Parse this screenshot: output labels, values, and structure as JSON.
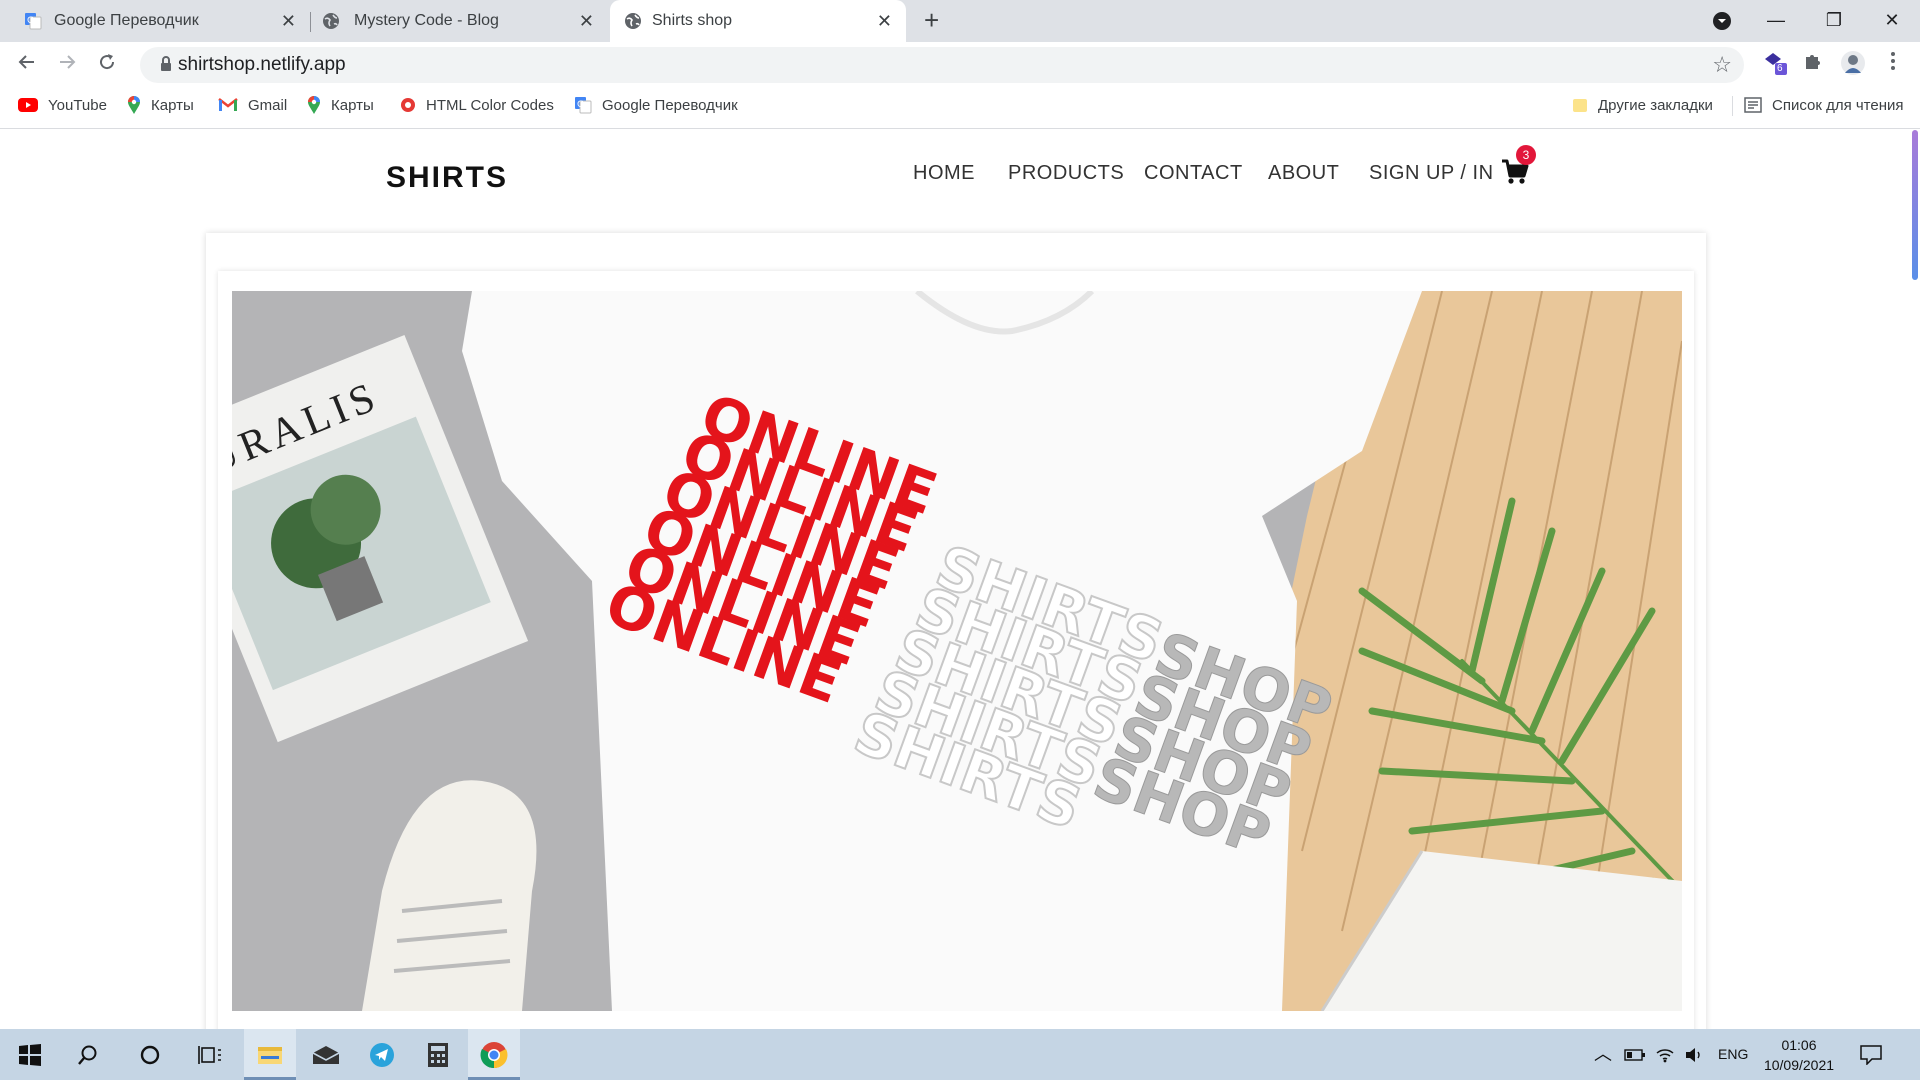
{
  "browser": {
    "tabs": [
      {
        "title": "Google Переводчик",
        "icon": "google-translate-icon",
        "active": false
      },
      {
        "title": "Mystery Code - Blog",
        "icon": "globe-icon",
        "active": false
      },
      {
        "title": "Shirts shop",
        "icon": "globe-icon",
        "active": true
      }
    ],
    "url": "shirtshop.netlify.app",
    "extension_badge": "6",
    "bookmarks": [
      {
        "label": "YouTube",
        "icon": "youtube-icon"
      },
      {
        "label": "Карты",
        "icon": "maps-pin-icon"
      },
      {
        "label": "Gmail",
        "icon": "gmail-icon"
      },
      {
        "label": "Карты",
        "icon": "maps-pin-icon"
      },
      {
        "label": "HTML Color Codes",
        "icon": "color-codes-icon"
      },
      {
        "label": "Google Переводчик",
        "icon": "google-translate-icon"
      }
    ],
    "other_bookmarks": "Другие закладки",
    "reading_list": "Список для чтения"
  },
  "site": {
    "logo": "SHIRTS",
    "nav": [
      "HOME",
      "PRODUCTS",
      "CONTACT",
      "ABOUT",
      "SIGN UP / IN"
    ],
    "cart_count": "3",
    "hero": {
      "word_red": "ONLINE",
      "word_white": "SHIRTS",
      "word_grey": "SHOP",
      "magazine_text": "TURALIS",
      "colors": {
        "red": "#e4141b",
        "grey_bg": "#b4b4b6",
        "wood": "#e9c79a",
        "leaf": "#5e9a44"
      }
    }
  },
  "taskbar": {
    "lang": "ENG",
    "time": "01:06",
    "date": "10/09/2021"
  }
}
